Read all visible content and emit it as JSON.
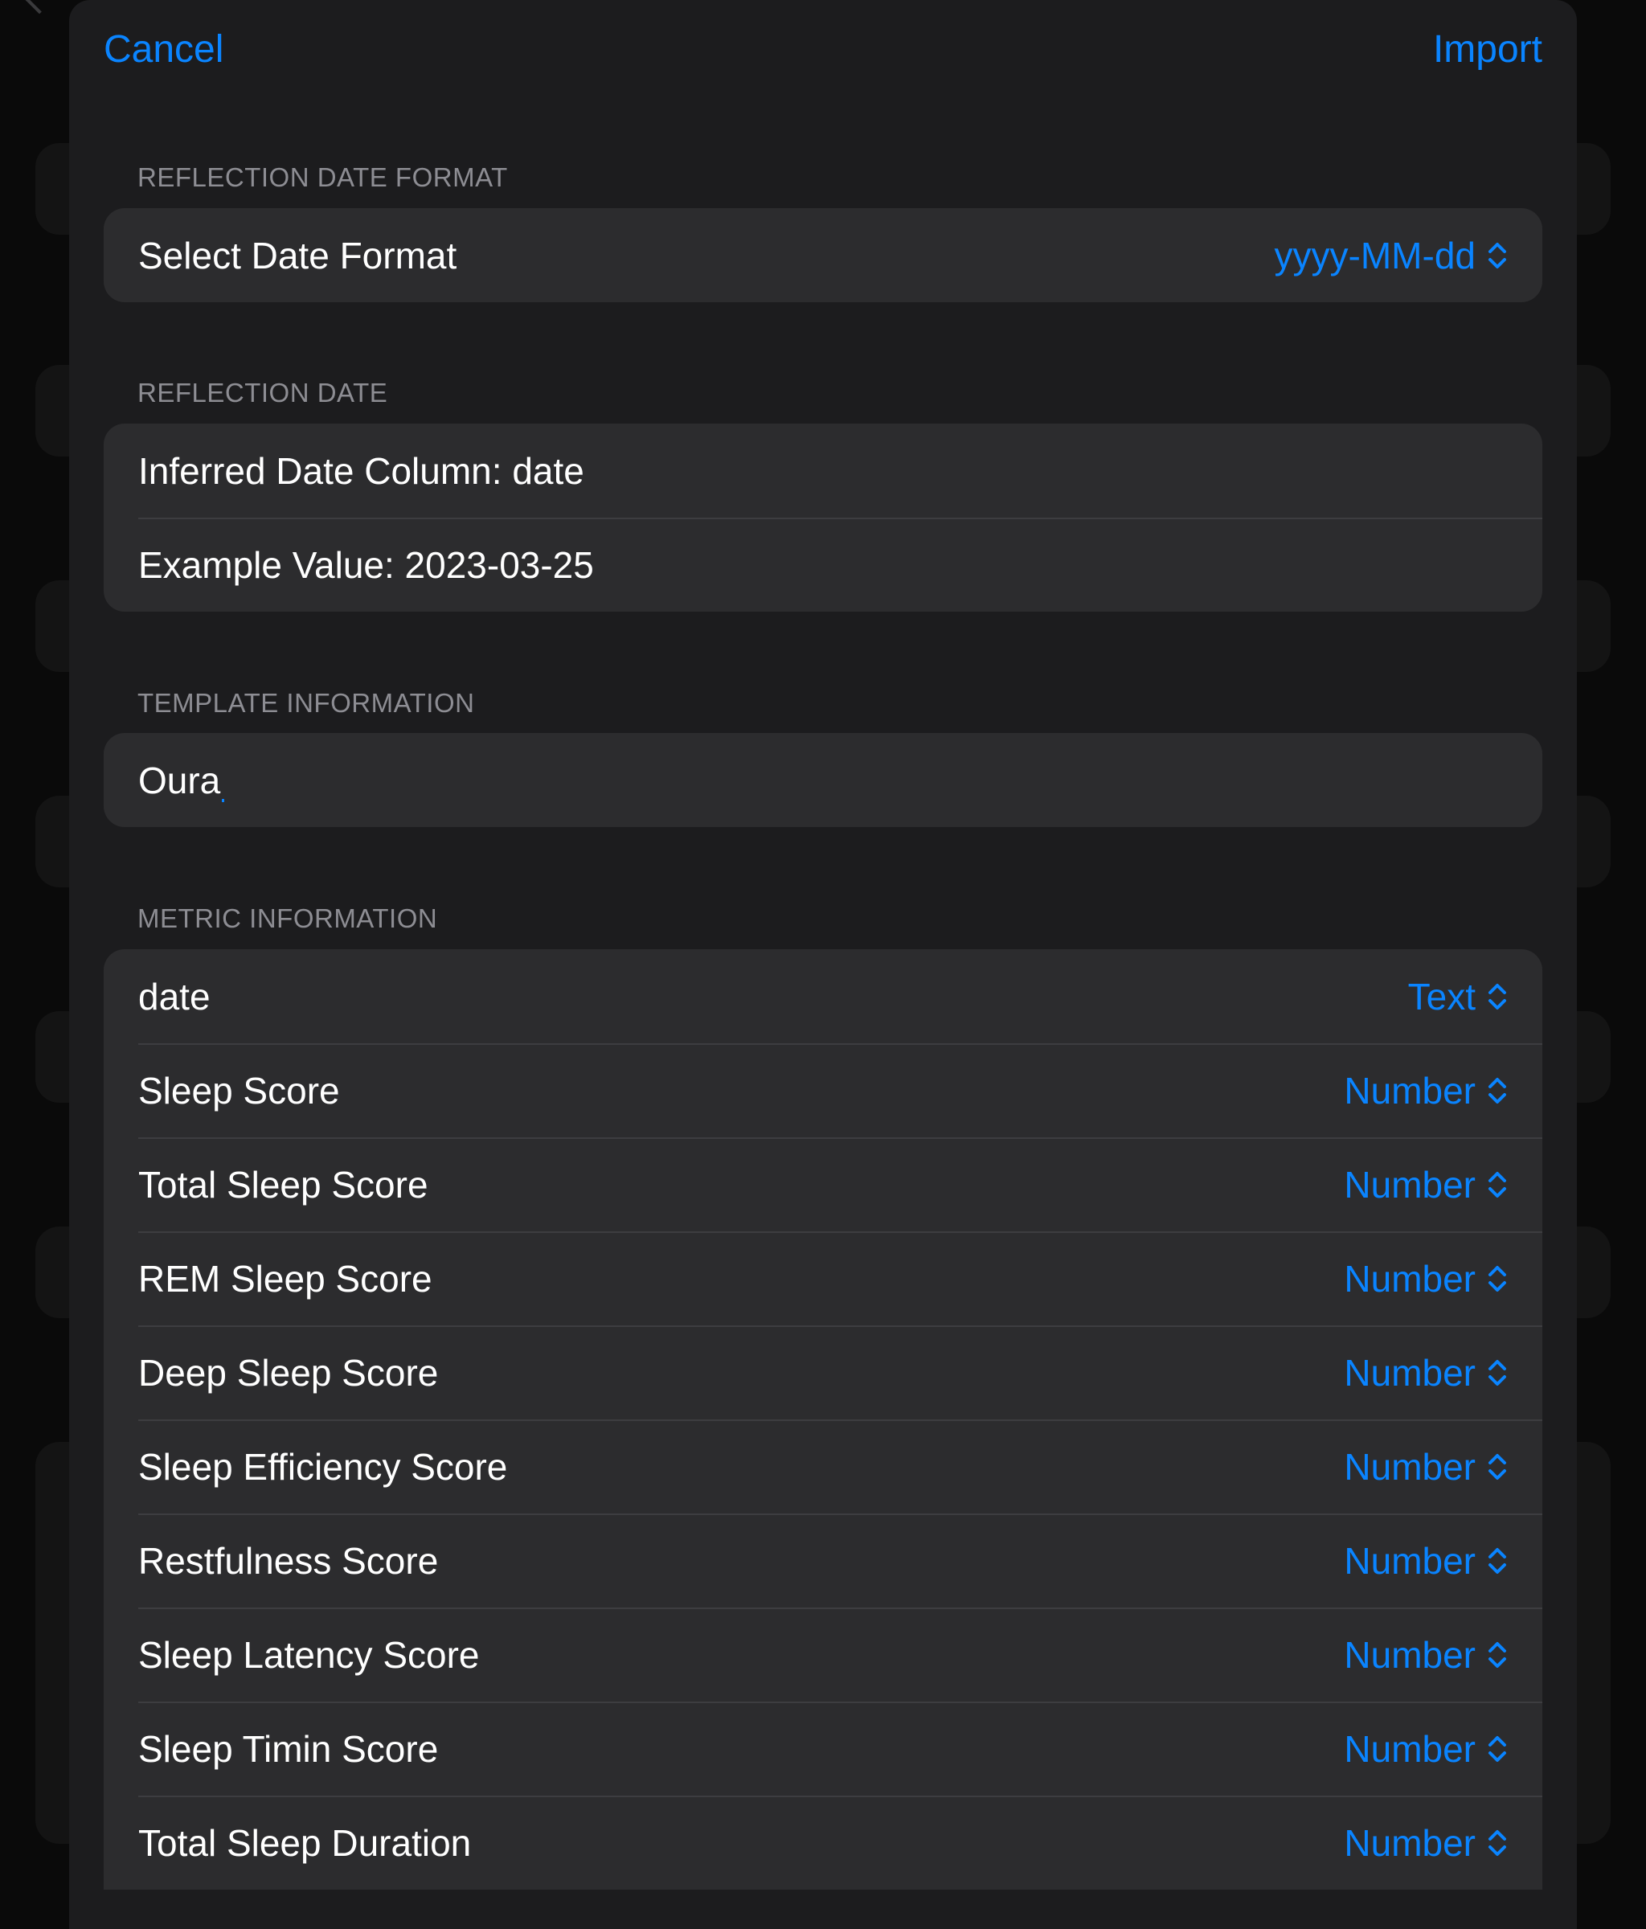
{
  "nav": {
    "cancel_label": "Cancel",
    "import_label": "Import"
  },
  "date_format_section": {
    "header": "REFLECTION DATE FORMAT",
    "label": "Select Date Format",
    "value": "yyyy-MM-dd"
  },
  "reflection_date_section": {
    "header": "REFLECTION DATE",
    "inferred_column": "Inferred Date Column: date",
    "example_value": "Example Value: 2023-03-25"
  },
  "template_section": {
    "header": "TEMPLATE INFORMATION",
    "name_value": "Oura"
  },
  "metric_section": {
    "header": "METRIC INFORMATION",
    "rows": [
      {
        "name": "date",
        "type": "Text"
      },
      {
        "name": "Sleep Score",
        "type": "Number"
      },
      {
        "name": "Total Sleep Score",
        "type": "Number"
      },
      {
        "name": "REM Sleep Score",
        "type": "Number"
      },
      {
        "name": "Deep Sleep Score",
        "type": "Number"
      },
      {
        "name": "Sleep Efficiency Score",
        "type": "Number"
      },
      {
        "name": "Restfulness Score",
        "type": "Number"
      },
      {
        "name": "Sleep Latency Score",
        "type": "Number"
      },
      {
        "name": "Sleep Timin Score",
        "type": "Number"
      },
      {
        "name": "Total Sleep Duration",
        "type": "Number"
      }
    ]
  },
  "colors": {
    "accent": "#0a84ff",
    "sheet_background": "#1c1c1e",
    "cell_background": "#2c2c2e",
    "header_text": "#8d8d93"
  },
  "icons": {
    "picker_indicator": "chevron-up-down-icon",
    "back": "chevron-left-icon"
  }
}
